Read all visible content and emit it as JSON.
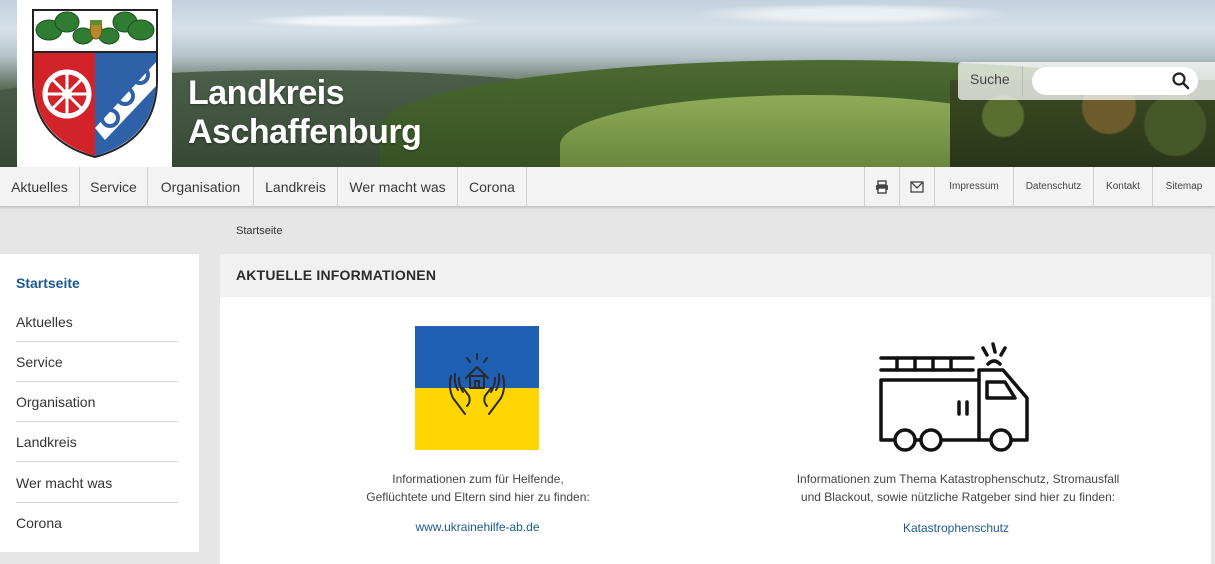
{
  "site": {
    "title_line1": "Landkreis",
    "title_line2": "Aschaffenburg"
  },
  "search": {
    "label": "Suche",
    "placeholder": ""
  },
  "nav": {
    "items": [
      "Aktuelles",
      "Service",
      "Organisation",
      "Landkreis",
      "Wer macht was",
      "Corona"
    ],
    "right": [
      "Impressum",
      "Datenschutz",
      "Kontakt",
      "Sitemap"
    ],
    "icons": [
      "print-icon",
      "mail-icon"
    ]
  },
  "breadcrumb": "Startseite",
  "sidebar": {
    "items": [
      "Startseite",
      "Aktuelles",
      "Service",
      "Organisation",
      "Landkreis",
      "Wer macht was",
      "Corona"
    ]
  },
  "main": {
    "title": "AKTUELLE INFORMATIONEN",
    "cards": [
      {
        "text_line1": "Informationen zum für Helfende,",
        "text_line2": "Geflüchtete und Eltern sind hier zu finden:",
        "link": "www.ukrainehilfe-ab.de",
        "icon": "ukraine-help-icon"
      },
      {
        "text_line1": "Informationen zum Thema Katastrophenschutz, Stromausfall",
        "text_line2": "und Blackout, sowie nützliche Ratgeber sind hier zu finden:",
        "link": "Katastrophenschutz",
        "icon": "fire-truck-icon"
      }
    ]
  },
  "colors": {
    "accent": "#1d5a93",
    "ukraine_blue": "#1f5fb4",
    "ukraine_yellow": "#ffd500",
    "coat_red": "#d2232a",
    "coat_blue": "#2e61a8",
    "coat_green": "#2e7d32"
  }
}
